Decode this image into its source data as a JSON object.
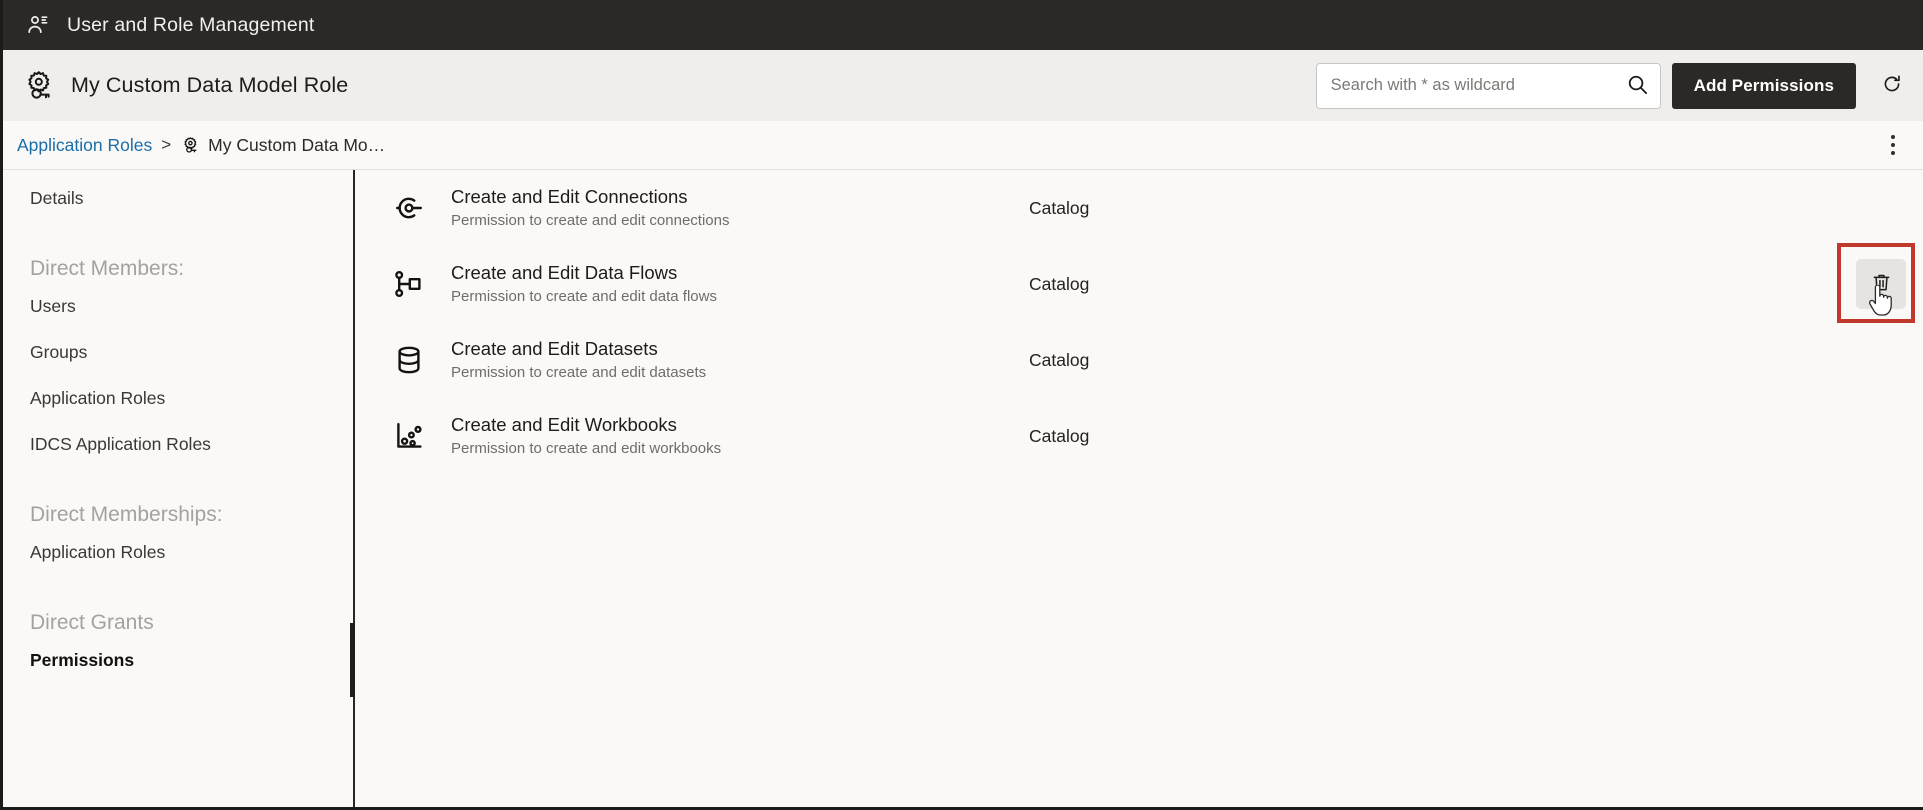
{
  "appbar": {
    "title": "User and Role Management",
    "icon": "users-roles-icon"
  },
  "object_header": {
    "icon": "application-role-icon",
    "title": "My Custom Data Model Role",
    "search": {
      "placeholder": "Search with * as wildcard",
      "value": "",
      "icon": "search-icon"
    },
    "add_permissions_label": "Add Permissions",
    "refresh_icon": "refresh-icon"
  },
  "breadcrumb": {
    "parent": "Application Roles",
    "separator": ">",
    "current_icon": "application-role-icon",
    "current": "My Custom Data Mo…",
    "overflow_icon": "kebab-menu-icon"
  },
  "sidebar": {
    "top_items": [
      {
        "label": "Details",
        "selected": false
      }
    ],
    "groups": [
      {
        "heading": "Direct Members:",
        "items": [
          {
            "label": "Users",
            "selected": false
          },
          {
            "label": "Groups",
            "selected": false
          },
          {
            "label": "Application Roles",
            "selected": false
          },
          {
            "label": "IDCS Application Roles",
            "selected": false
          }
        ]
      },
      {
        "heading": "Direct Memberships:",
        "items": [
          {
            "label": "Application Roles",
            "selected": false
          }
        ]
      },
      {
        "heading": "Direct Grants",
        "items": [
          {
            "label": "Permissions",
            "selected": true
          }
        ]
      }
    ]
  },
  "permissions": {
    "rows": [
      {
        "icon": "connection-icon",
        "title": "Create and Edit Connections",
        "description": "Permission to create and edit connections",
        "category": "Catalog",
        "hovered": false,
        "delete_icon": "trash-icon"
      },
      {
        "icon": "data-flow-icon",
        "title": "Create and Edit Data Flows",
        "description": "Permission to create and edit data flows",
        "category": "Catalog",
        "hovered": true,
        "delete_icon": "trash-icon"
      },
      {
        "icon": "dataset-icon",
        "title": "Create and Edit Datasets",
        "description": "Permission to create and edit datasets",
        "category": "Catalog",
        "hovered": false,
        "delete_icon": "trash-icon"
      },
      {
        "icon": "workbook-icon",
        "title": "Create and Edit Workbooks",
        "description": "Permission to create and edit workbooks",
        "category": "Catalog",
        "hovered": false,
        "delete_icon": "trash-icon"
      }
    ]
  },
  "annotation": {
    "color": "#c0392b",
    "target": "delete-permission-button"
  },
  "colors": {
    "appbar_bg": "#2b2825",
    "header_bg": "#efeeec",
    "page_bg": "#faf9f8",
    "link": "#1a6ea8",
    "primary_button_bg": "#2b2825",
    "annotation": "#c0392b"
  }
}
